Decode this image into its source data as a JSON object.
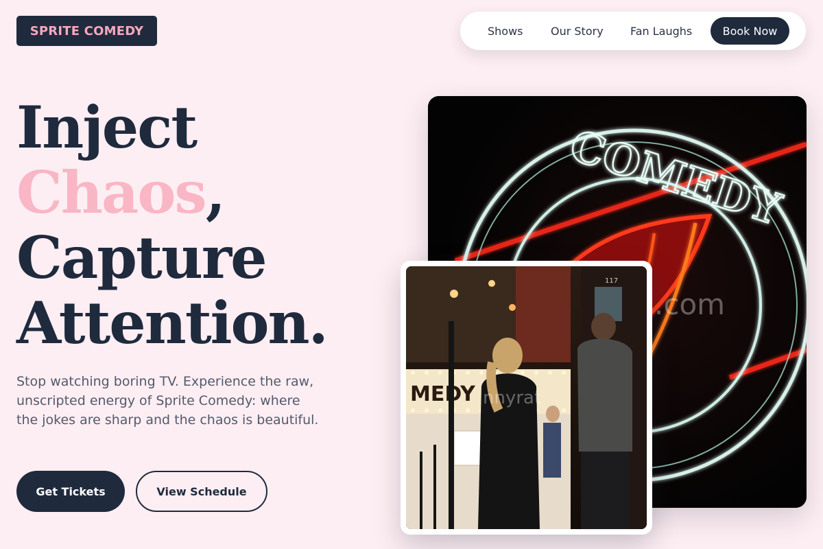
{
  "brand": {
    "logo_text": "SPRITE COMEDY"
  },
  "nav": {
    "items": [
      {
        "label": "Shows"
      },
      {
        "label": "Our Story"
      },
      {
        "label": "Fan Laughs"
      }
    ],
    "cta_label": "Book Now"
  },
  "hero": {
    "headline": {
      "line1": "Inject",
      "accent_word": "Chaos",
      "accent_suffix": ",",
      "line3": "Capture",
      "line4": "Attention."
    },
    "subtext": "Stop watching boring TV. Experience the raw, unscripted energy of Sprite Comedy: where the jokes are sharp and the chaos is beautiful.",
    "primary_button": "Get Tickets",
    "secondary_button": "View Schedule"
  },
  "images": {
    "main": {
      "sign_text": "COMEDY",
      "watermark": ".com"
    },
    "secondary": {
      "marquee_text": "MEDY   BAR",
      "door_number": "117",
      "watermark": "nnyrat"
    }
  },
  "colors": {
    "background": "#fdeef3",
    "navy": "#1f2a3d",
    "accent_pink": "#f9b6c5",
    "logo_pink": "#f6a9bb"
  }
}
